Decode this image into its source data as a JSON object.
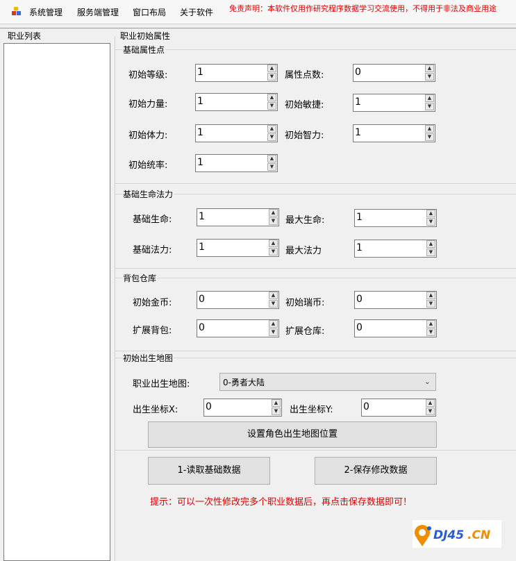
{
  "menu": {
    "items": [
      "系统管理",
      "服务端管理",
      "窗口布局",
      "关于软件"
    ],
    "disclaimer": "免责声明：本软件仅用作研究程序数据学习交流使用，不得用于非法及商业用途"
  },
  "left_panel": {
    "title": "职业列表"
  },
  "right_panel": {
    "title": "职业初始属性"
  },
  "groups": {
    "base_attr": {
      "title": "基础属性点",
      "fields": [
        {
          "label": "初始等级:",
          "value": "1"
        },
        {
          "label": "属性点数:",
          "value": "0"
        },
        {
          "label": "初始力量:",
          "value": "1"
        },
        {
          "label": "初始敏捷:",
          "value": "1"
        },
        {
          "label": "初始体力:",
          "value": "1"
        },
        {
          "label": "初始智力:",
          "value": "1"
        },
        {
          "label": "初始统率:",
          "value": "1"
        }
      ]
    },
    "hp_mp": {
      "title": "基础生命法力",
      "fields": [
        {
          "label": "基础生命:",
          "value": "1"
        },
        {
          "label": "最大生命:",
          "value": "1"
        },
        {
          "label": "基础法力:",
          "value": "1"
        },
        {
          "label": "最大法力",
          "value": "1"
        }
      ]
    },
    "bag": {
      "title": "背包仓库",
      "fields": [
        {
          "label": "初始金币:",
          "value": "0"
        },
        {
          "label": "初始瑞币:",
          "value": "0"
        },
        {
          "label": "扩展背包:",
          "value": "0"
        },
        {
          "label": "扩展仓库:",
          "value": "0"
        }
      ]
    },
    "spawn": {
      "title": "初始出生地图",
      "map_label": "职业出生地图:",
      "map_value": "0-勇者大陆",
      "x_label": "出生坐标X:",
      "x_value": "0",
      "y_label": "出生坐标Y:",
      "y_value": "0",
      "set_button": "设置角色出生地图位置"
    }
  },
  "actions": {
    "read_button": "1-读取基础数据",
    "save_button": "2-保存修改数据"
  },
  "hint": "提示：可以一次性修改完多个职业数据后，再点击保存数据即可！",
  "logo_text": "DJ45.CN",
  "colors": {
    "warning_red": "#e00000",
    "logo_orange": "#f28c00",
    "logo_blue": "#2a5bd7"
  },
  "icons": {
    "app": "app-window-icon",
    "spin_up": "arrow-up-icon",
    "spin_down": "arrow-down-icon",
    "combo": "chevron-down-icon"
  }
}
